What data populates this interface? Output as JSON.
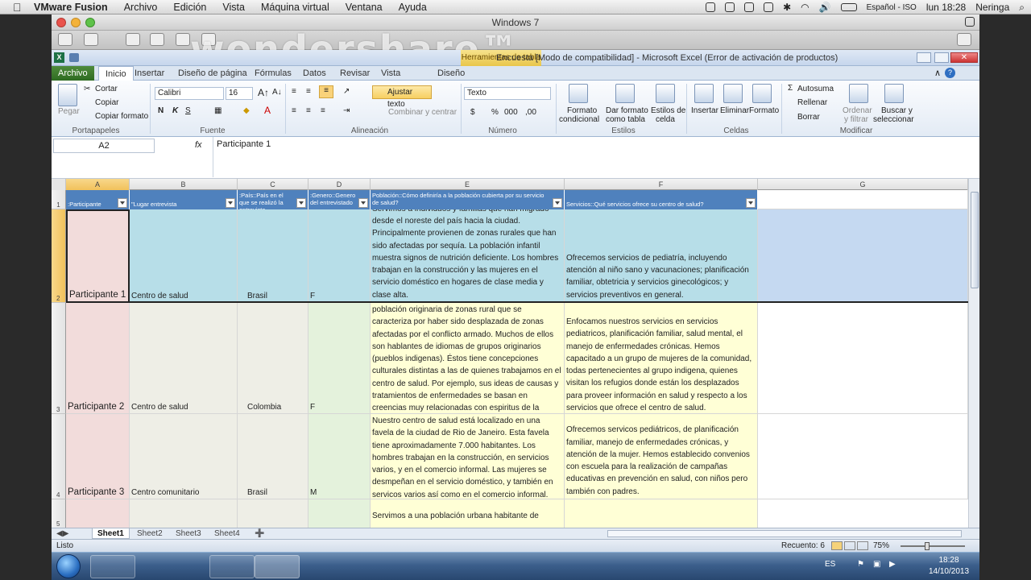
{
  "mac": {
    "app": "VMware Fusion",
    "menus": [
      "Archivo",
      "Edición",
      "Vista",
      "Máquina virtual",
      "Ventana",
      "Ayuda"
    ],
    "lang": "Español - ISO",
    "clock": "lun 18:28",
    "user": "Neringa"
  },
  "vm": {
    "title": "Windows 7",
    "watermark": "wondershare™"
  },
  "excel": {
    "title": "Encuesta  [Modo de compatibilidad]  -  Microsoft Excel (Error de activación de productos)",
    "context_tab": "Herramientas de tabla",
    "tabs": [
      "Archivo",
      "Inicio",
      "Insertar",
      "Diseño de página",
      "Fórmulas",
      "Datos",
      "Revisar",
      "Vista",
      "Diseño"
    ],
    "ribbon": {
      "paste": "Pegar",
      "cut": "Cortar",
      "copy": "Copiar",
      "copy_format": "Copiar formato",
      "clipboard": "Portapapeles",
      "font_name": "Calibri",
      "font_size": "16",
      "font_group": "Fuente",
      "wrap_text": "Ajustar texto",
      "merge": "Combinar y centrar",
      "align_group": "Alineación",
      "number_format": "Texto",
      "number_group": "Número",
      "cond_format_1": "Formato",
      "cond_format_2": "condicional",
      "table_format_1": "Dar formato",
      "table_format_2": "como tabla",
      "cell_styles_1": "Estilos de",
      "cell_styles_2": "celda",
      "styles_group": "Estilos",
      "insert": "Insertar",
      "delete": "Eliminar",
      "format": "Formato",
      "cells_group": "Celdas",
      "autosum": "Autosuma",
      "fill": "Rellenar",
      "clear": "Borrar",
      "sort_1": "Ordenar",
      "sort_2": "y filtrar",
      "find_1": "Buscar y",
      "find_2": "seleccionar",
      "edit_group": "Modificar"
    },
    "name_box": "A2",
    "formula": "Participante 1",
    "columns": [
      "A",
      "B",
      "C",
      "D",
      "E",
      "F",
      "G"
    ],
    "headers": [
      ":Participante",
      "\"Lugar entrevista",
      ":País::País en el que se realizó la entrevista",
      ":Genero::Genero del entrevistado",
      "Población::Cómo definiría a la población cubierta por su servicio de salud?",
      "Servicios::Qué servicios ofrece su centro de salud?",
      ""
    ],
    "rows": [
      {
        "num": "2",
        "a": "Participante 1",
        "b": "Centro de salud",
        "c": "Brasil",
        "d": "F",
        "e": "Servimos a individuos y familias que han migrado desde el noreste del país hacia la ciudad. Principalmente provienen de zonas rurales que han sido afectadas por sequía.  La población infantil muestra signos de nutrición deficiente.  Los hombres trabajan en la construcción y las mujeres en el servicio doméstico en hogares de clase media y clase alta.",
        "f": "Ofrecemos servicios de pediatría, incluyendo atención al niño sano y vacunaciones; planificación familiar, obtetricia y servicios ginecológicos; y servicios preventivos en general."
      },
      {
        "num": "3",
        "a": "Participante 2",
        "b": "Centro de salud",
        "c": "Colombia",
        "d": "F",
        "e": "población originaria de zonas rural que se caracteriza por haber sido desplazada de zonas afectadas por el conflicto armado.  Muchos de ellos son hablantes de idiomas de grupos originarios (pueblos indigenas). Éstos tiene concepciones culturales distintas a las de quienes trabajamos en el centro de salud.  Por ejemplo,  sus ideas de causas y tratamientos de enfermedades se basan en creencias muy relacionadas con espiritus de la",
        "f": "Enfocamos nuestros servicios en servicios pediatricos, planificación familiar, salud mental, el manejo de enfermedades crónicas.  Hemos capacitado a un grupo de mujeres de la comunidad, todas pertenecientes al grupo indigena, quienes visitan los refugios donde están los desplazados para proveer información en salud y respecto a los servicios que ofrece el centro de salud."
      },
      {
        "num": "4",
        "a": "Participante 3",
        "b": "Centro comunitario",
        "c": "Brasil",
        "d": "M",
        "e": "Nuestro centro de salud está localizado en una favela  de la ciudad de Rio de Janeiro.  Esta favela tiene aproximadamente 7.000 habitantes.  Los hombres trabajan en la construcción, en servicios varios, y en el comercio informal.  Las mujeres se desmpeñan en el servicio doméstico, y también en servicos varios así como en el comercio informal.",
        "f": "Ofrecemos servicos pediátricos, de planificación familiar, manejo de enfermedades crónicas, y atención de la mujer.  Hemos establecido convenios con escuela para la realización de campañas educativas en prevención en salud, con niños pero también con padres."
      },
      {
        "num": "5",
        "a": "",
        "b": "",
        "c": "",
        "d": "",
        "e": "Servimos a una población urbana habitante de",
        "f": ""
      }
    ],
    "sheets": [
      "Sheet1",
      "Sheet2",
      "Sheet3",
      "Sheet4"
    ],
    "status_ready": "Listo",
    "status_count": "Recuento: 6",
    "zoom": "75%"
  },
  "win": {
    "lang": "ES",
    "time": "18:28",
    "date": "14/10/2013"
  }
}
